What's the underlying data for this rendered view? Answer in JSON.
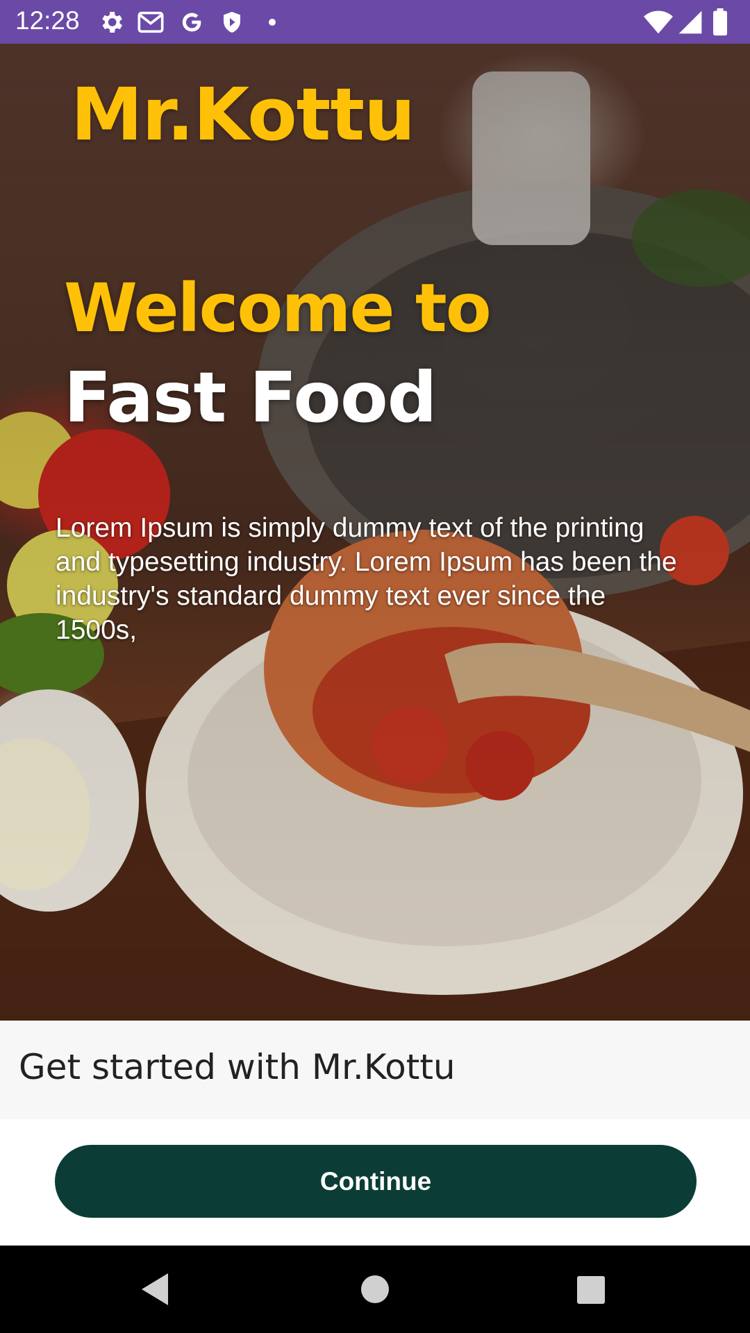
{
  "status_bar": {
    "time": "12:28",
    "background_color": "#6a4aa6",
    "left_icons": [
      "settings-icon",
      "gmail-icon",
      "google-icon",
      "shield-icon",
      "dot-icon"
    ],
    "right_icons": [
      "wifi-icon",
      "signal-icon",
      "battery-icon"
    ]
  },
  "hero": {
    "brand": "Mr.Kottu",
    "welcome": "Welcome to",
    "headline": "Fast Food",
    "paragraph": "Lorem Ipsum is simply dummy text of the printing and typesetting industry. Lorem Ipsum has been the industry's standard dummy text ever since the  1500s,",
    "accent_color": "#ffc107"
  },
  "get_started": {
    "text": "Get started with Mr.Kottu"
  },
  "continue_button": {
    "label": "Continue",
    "color": "#0b3d36"
  },
  "nav_bar": {
    "buttons": [
      "back-icon",
      "home-icon",
      "recents-icon"
    ]
  }
}
